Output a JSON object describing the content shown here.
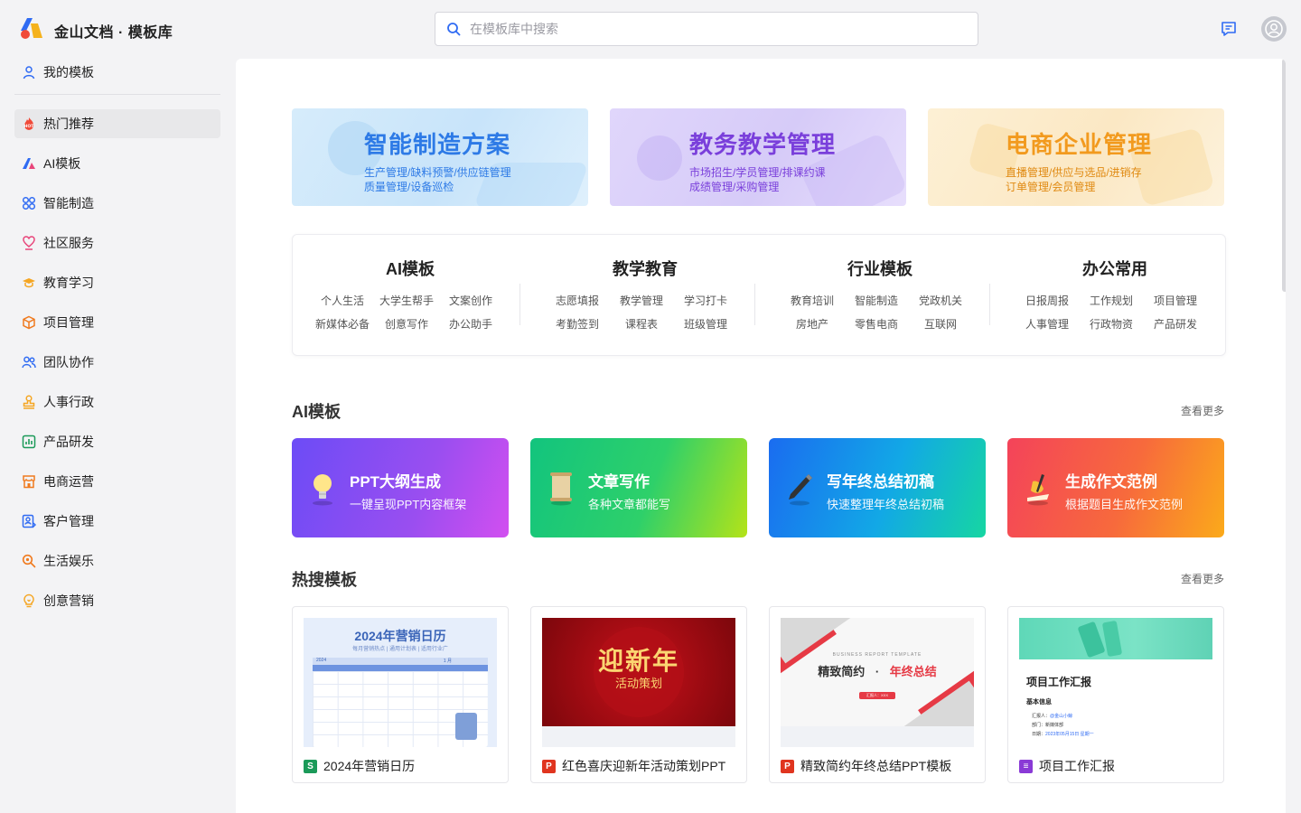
{
  "header": {
    "brand": "金山文档 · 模板库",
    "search_placeholder": "在模板库中搜索"
  },
  "sidebar": {
    "my_templates": "我的模板",
    "items": [
      {
        "label": "热门推荐",
        "icon": "hot-icon",
        "active": true
      },
      {
        "label": "AI模板",
        "icon": "ai-icon"
      },
      {
        "label": "智能制造",
        "icon": "manufacturing-icon"
      },
      {
        "label": "社区服务",
        "icon": "community-icon"
      },
      {
        "label": "教育学习",
        "icon": "graduation-cap-icon"
      },
      {
        "label": "项目管理",
        "icon": "box-icon"
      },
      {
        "label": "团队协作",
        "icon": "team-icon"
      },
      {
        "label": "人事行政",
        "icon": "stamp-icon"
      },
      {
        "label": "产品研发",
        "icon": "chart-icon"
      },
      {
        "label": "电商运营",
        "icon": "store-icon"
      },
      {
        "label": "客户管理",
        "icon": "customer-icon"
      },
      {
        "label": "生活娱乐",
        "icon": "entertainment-icon"
      },
      {
        "label": "创意营销",
        "icon": "bulb-icon"
      }
    ]
  },
  "banners": [
    {
      "title": "智能制造方案",
      "line1": "生产管理/缺料预警/供应链管理",
      "line2": "质量管理/设备巡检"
    },
    {
      "title": "教务教学管理",
      "line1": "市场招生/学员管理/排课约课",
      "line2": "成绩管理/采购管理"
    },
    {
      "title": "电商企业管理",
      "line1": "直播管理/供应与选品/进销存",
      "line2": "订单管理/会员管理"
    }
  ],
  "categories": [
    {
      "title": "AI模板",
      "links": [
        "个人生活",
        "大学生帮手",
        "文案创作",
        "新媒体必备",
        "创意写作",
        "办公助手"
      ]
    },
    {
      "title": "教学教育",
      "links": [
        "志愿填报",
        "教学管理",
        "学习打卡",
        "考勤签到",
        "课程表",
        "班级管理"
      ]
    },
    {
      "title": "行业模板",
      "links": [
        "教育培训",
        "智能制造",
        "党政机关",
        "房地产",
        "零售电商",
        "互联网"
      ]
    },
    {
      "title": "办公常用",
      "links": [
        "日报周报",
        "工作规划",
        "项目管理",
        "人事管理",
        "行政物资",
        "产品研发"
      ]
    }
  ],
  "ai_section": {
    "title": "AI模板",
    "more": "查看更多",
    "cards": [
      {
        "title": "PPT大纲生成",
        "subtitle": "一键呈现PPT内容框架",
        "icon": "lightbulb-icon"
      },
      {
        "title": "文章写作",
        "subtitle": "各种文章都能写",
        "icon": "scroll-icon"
      },
      {
        "title": "写年终总结初稿",
        "subtitle": "快速整理年终总结初稿",
        "icon": "pen-icon"
      },
      {
        "title": "生成作文范例",
        "subtitle": "根据题目生成作文范例",
        "icon": "writing-hand-icon"
      }
    ]
  },
  "hot_section": {
    "title": "热搜模板",
    "more": "查看更多",
    "cards": [
      {
        "name": "2024年营销日历",
        "type": "S",
        "type_color": "#1b9a59",
        "thumb": {
          "title": "2024年营销日历",
          "sub": "每月营销热点 | 通用计划表 | 适用行业广",
          "year": "2024",
          "month": "1 月"
        }
      },
      {
        "name": "红色喜庆迎新年活动策划PPT",
        "type": "P",
        "type_color": "#e0351f",
        "thumb": {
          "title": "迎新年",
          "sub": "活动策划"
        }
      },
      {
        "name": "精致简约年终总结PPT模板",
        "type": "P",
        "type_color": "#e0351f",
        "thumb": {
          "eyebrow": "BUSINESS REPORT TEMPLATE",
          "left": "精致简约",
          "dot": "·",
          "right": "年终总结",
          "btn": "汇报人：XXX"
        }
      },
      {
        "name": "项目工作汇报",
        "type": "≡",
        "type_color": "#8a3ad6",
        "thumb": {
          "title": "项目工作汇报",
          "section": "基本信息",
          "r1k": "汇报人：",
          "r1v": "@金山小鲸",
          "r2": "部门：新媒体部",
          "r3k": "日期：",
          "r3v": "2023年05月15日 星期一"
        }
      }
    ]
  },
  "colors": {
    "accent": "#2f6bf3",
    "banner1": "#2d7ae6",
    "banner2": "#7a3fdb",
    "banner3": "#f29a1e"
  }
}
